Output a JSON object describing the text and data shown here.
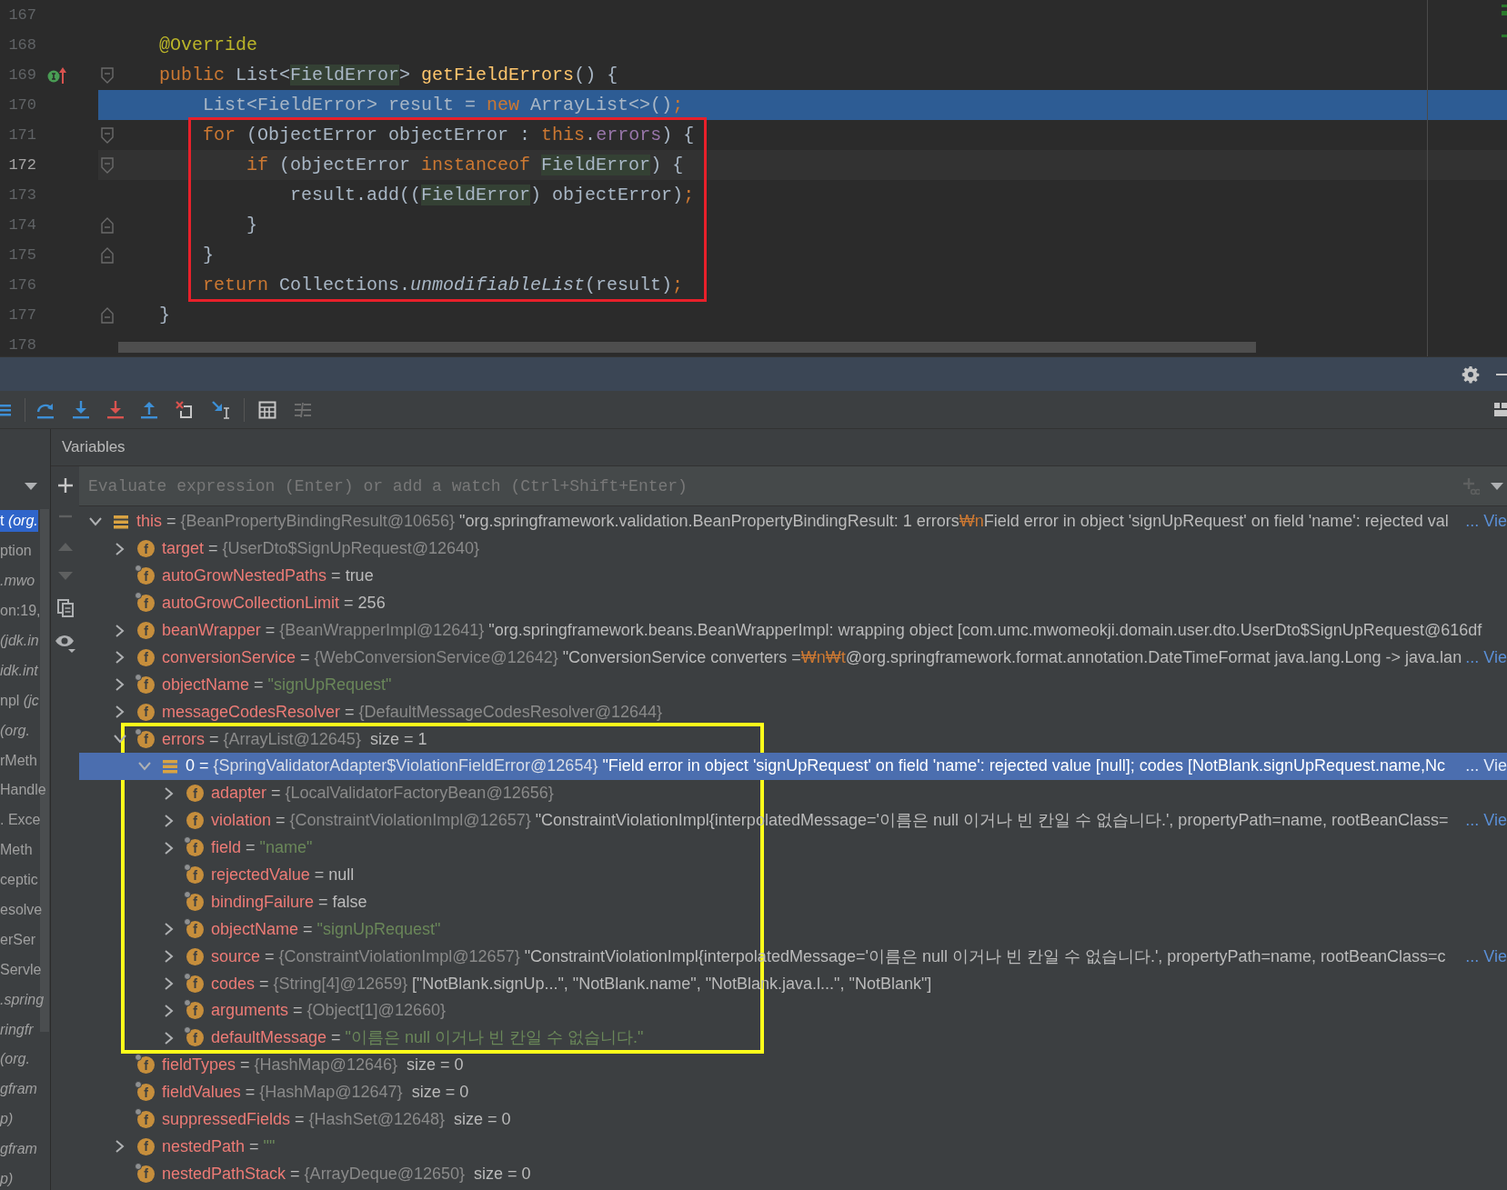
{
  "editor": {
    "lines": [
      {
        "number": "167",
        "execution_point": false,
        "caret": false,
        "boxed": false,
        "implemented": false,
        "fold_start": false,
        "fold_end": false
      },
      {
        "number": "168",
        "execution_point": false,
        "caret": false,
        "boxed": false,
        "implemented": false,
        "fold_start": false,
        "fold_end": false,
        "tokens": [
          {
            "text": "    @Override",
            "kind": "annotation"
          }
        ]
      },
      {
        "number": "169",
        "execution_point": false,
        "caret": false,
        "boxed": false,
        "implemented": true,
        "fold_start": true,
        "fold_end": false,
        "tokens": [
          {
            "text": "    public",
            "kind": "keyword"
          },
          {
            "text": " List<",
            "kind": "plain"
          },
          {
            "text": "FieldError",
            "kind": "usage"
          },
          {
            "text": "> ",
            "kind": "plain"
          },
          {
            "text": "getFieldErrors",
            "kind": "method"
          },
          {
            "text": "() {",
            "kind": "plain"
          }
        ]
      },
      {
        "number": "170",
        "execution_point": true,
        "caret": false,
        "boxed": false,
        "implemented": false,
        "fold_start": false,
        "fold_end": false,
        "tokens": [
          {
            "text": "        List<FieldError> result = ",
            "kind": "plain"
          },
          {
            "text": "new",
            "kind": "keyword"
          },
          {
            "text": " ArrayList<>()",
            "kind": "plain"
          },
          {
            "text": ";",
            "kind": "keyword"
          }
        ]
      },
      {
        "number": "171",
        "execution_point": false,
        "caret": false,
        "boxed": true,
        "implemented": false,
        "fold_start": true,
        "fold_end": false,
        "tokens": [
          {
            "text": "        for",
            "kind": "keyword"
          },
          {
            "text": " (ObjectError objectError : ",
            "kind": "plain"
          },
          {
            "text": "this",
            "kind": "keyword"
          },
          {
            "text": ".",
            "kind": "plain"
          },
          {
            "text": "errors",
            "kind": "field"
          },
          {
            "text": ") {",
            "kind": "plain"
          }
        ]
      },
      {
        "number": "172",
        "execution_point": false,
        "caret": true,
        "boxed": true,
        "implemented": false,
        "fold_start": true,
        "fold_end": false,
        "tokens": [
          {
            "text": "            if",
            "kind": "keyword"
          },
          {
            "text": " (objectError ",
            "kind": "plain"
          },
          {
            "text": "instanceof ",
            "kind": "keyword"
          },
          {
            "text": "FieldError",
            "kind": "usage"
          },
          {
            "text": ") {",
            "kind": "plain"
          }
        ]
      },
      {
        "number": "173",
        "execution_point": false,
        "caret": false,
        "boxed": true,
        "implemented": false,
        "fold_start": false,
        "fold_end": false,
        "tokens": [
          {
            "text": "                result.add((",
            "kind": "plain"
          },
          {
            "text": "FieldError",
            "kind": "usage"
          },
          {
            "text": ") objectError)",
            "kind": "plain"
          },
          {
            "text": ";",
            "kind": "keyword"
          }
        ]
      },
      {
        "number": "174",
        "execution_point": false,
        "caret": false,
        "boxed": true,
        "implemented": false,
        "fold_start": false,
        "fold_end": true,
        "tokens": [
          {
            "text": "            }",
            "kind": "plain"
          }
        ]
      },
      {
        "number": "175",
        "execution_point": false,
        "caret": false,
        "boxed": true,
        "implemented": false,
        "fold_start": false,
        "fold_end": true,
        "tokens": [
          {
            "text": "        }",
            "kind": "plain"
          }
        ]
      },
      {
        "number": "176",
        "execution_point": false,
        "caret": false,
        "boxed": true,
        "implemented": false,
        "fold_start": false,
        "fold_end": false,
        "tokens": [
          {
            "text": "        return",
            "kind": "keyword"
          },
          {
            "text": " Collections.",
            "kind": "plain"
          },
          {
            "text": "unmodifiableList",
            "kind": "static"
          },
          {
            "text": "(result)",
            "kind": "plain"
          },
          {
            "text": ";",
            "kind": "keyword"
          }
        ]
      },
      {
        "number": "177",
        "execution_point": false,
        "caret": false,
        "boxed": false,
        "implemented": false,
        "fold_start": false,
        "fold_end": true,
        "tokens": [
          {
            "text": "    }",
            "kind": "plain"
          }
        ]
      },
      {
        "number": "178",
        "execution_point": false,
        "caret": false,
        "boxed": false,
        "implemented": false,
        "fold_start": false,
        "fold_end": false
      }
    ]
  },
  "frames": [
    {
      "text": "t *(org.*",
      "selected": true
    },
    {
      "text": "ption",
      "selected": false
    },
    {
      "text": "*.mwo*",
      "selected": false
    },
    {
      "text": "on:19,",
      "selected": false
    },
    {
      "text": "*(jdk.in*",
      "selected": false
    },
    {
      "text": "*idk.int*",
      "selected": false
    },
    {
      "text": "npl *(jc*",
      "selected": false
    },
    {
      "text": "*(org.*",
      "selected": false
    },
    {
      "text": "rMeth",
      "selected": false
    },
    {
      "text": "Handle",
      "selected": false
    },
    {
      "text": ". Exce",
      "selected": false
    },
    {
      "text": "Meth",
      "selected": false
    },
    {
      "text": "ceptic",
      "selected": false
    },
    {
      "text": "esolve",
      "selected": false
    },
    {
      "text": "erSer",
      "selected": false
    },
    {
      "text": "Servle",
      "selected": false
    },
    {
      "text": "*.spring*",
      "selected": false
    },
    {
      "text": "*ringfr*",
      "selected": false
    },
    {
      "text": "*(org.*",
      "selected": false
    },
    {
      "text": "*gfram*",
      "selected": false
    },
    {
      "text": "*p)*",
      "selected": false
    },
    {
      "text": "*gfram*",
      "selected": false
    },
    {
      "text": "*p)*",
      "selected": false
    }
  ],
  "variables_title": "Variables",
  "evaluate": {
    "placeholder": "Evaluate expression (Enter) or add a watch (Ctrl+Shift+Enter)"
  },
  "separator": "=",
  "variables": [
    {
      "kind": "object",
      "name": "this",
      "expanded": true,
      "selected": false,
      "boxed": false,
      "type_ref": "{BeanPropertyBindingResult@10656}",
      "value": [
        {
          "text": "\"org.springframework.validation.BeanPropertyBindingResult: 1 errors",
          "kind": "plain"
        },
        {
          "text": "₩n",
          "kind": "escape"
        },
        {
          "text": "Field error in object 'signUpRequest' on field 'name': rejected val",
          "kind": "plain"
        }
      ],
      "link": "... Vie",
      "children": [
        {
          "kind": "field",
          "badge": "f",
          "final": false,
          "name": "target",
          "expanded": false,
          "selected": false,
          "boxed": false,
          "type_ref": "{UserDto$SignUpRequest@12640}"
        },
        {
          "kind": "field",
          "badge": "f",
          "final": true,
          "name": "autoGrowNestedPaths",
          "selected": false,
          "boxed": false,
          "value": [
            {
              "text": "true",
              "kind": "plain"
            }
          ]
        },
        {
          "kind": "field",
          "badge": "f",
          "final": true,
          "name": "autoGrowCollectionLimit",
          "selected": false,
          "boxed": false,
          "value": [
            {
              "text": "256",
              "kind": "plain"
            }
          ]
        },
        {
          "kind": "field",
          "badge": "f",
          "final": false,
          "name": "beanWrapper",
          "expanded": false,
          "selected": false,
          "boxed": false,
          "type_ref": "{BeanWrapperImpl@12641}",
          "value": [
            {
              "text": "\"org.springframework.beans.BeanWrapperImpl: wrapping object [com.umc.mwomeokji.domain.user.dto.UserDto$SignUpRequest@616df",
              "kind": "plain"
            }
          ]
        },
        {
          "kind": "field",
          "badge": "f",
          "final": false,
          "name": "conversionService",
          "expanded": false,
          "selected": false,
          "boxed": false,
          "type_ref": "{WebConversionService@12642}",
          "value": [
            {
              "text": "\"ConversionService converters =",
              "kind": "plain"
            },
            {
              "text": "₩n₩t",
              "kind": "escape"
            },
            {
              "text": "@org.springframework.format.annotation.DateTimeFormat java.lang.Long -> java.lan",
              "kind": "plain"
            }
          ],
          "link": "... Vie"
        },
        {
          "kind": "field",
          "badge": "f",
          "final": true,
          "name": "objectName",
          "expanded": false,
          "selected": false,
          "boxed": false,
          "value": [
            {
              "text": "\"signUpRequest\"",
              "kind": "string"
            }
          ]
        },
        {
          "kind": "field",
          "badge": "f",
          "final": false,
          "name": "messageCodesResolver",
          "expanded": false,
          "selected": false,
          "boxed": false,
          "type_ref": "{DefaultMessageCodesResolver@12644}"
        },
        {
          "kind": "field",
          "badge": "f",
          "final": true,
          "name": "errors",
          "expanded": true,
          "selected": false,
          "boxed": true,
          "type_ref": "{ArrayList@12645}",
          "size": "size = 1",
          "children": [
            {
              "kind": "object",
              "name": "0",
              "expanded": true,
              "selected": true,
              "boxed": false,
              "type_ref": "{SpringValidatorAdapter$ViolationFieldError@12654}",
              "value": [
                {
                  "text": "\"Field error in object 'signUpRequest' on field 'name': rejected value [null]; codes [NotBlank.signUpRequest.name,Nc",
                  "kind": "plain"
                }
              ],
              "link": "... Vie",
              "children": [
                {
                  "kind": "field",
                  "badge": "f",
                  "final": false,
                  "name": "adapter",
                  "expanded": false,
                  "selected": false,
                  "boxed": false,
                  "type_ref": "{LocalValidatorFactoryBean@12656}"
                },
                {
                  "kind": "field",
                  "badge": "f",
                  "final": false,
                  "name": "violation",
                  "expanded": false,
                  "selected": false,
                  "boxed": false,
                  "type_ref": "{ConstraintViolationImpl@12657}",
                  "value": [
                    {
                      "text": "\"ConstraintViolationImpl{interpolatedMessage='이름은 null 이거나 빈 칸일 수 없습니다.', propertyPath=name, rootBeanClass=",
                      "kind": "plain"
                    }
                  ],
                  "link": "... Vie"
                },
                {
                  "kind": "field",
                  "badge": "f",
                  "final": true,
                  "name": "field",
                  "expanded": false,
                  "selected": false,
                  "boxed": false,
                  "value": [
                    {
                      "text": "\"name\"",
                      "kind": "string"
                    }
                  ]
                },
                {
                  "kind": "field",
                  "badge": "f",
                  "final": true,
                  "name": "rejectedValue",
                  "selected": false,
                  "boxed": false,
                  "value": [
                    {
                      "text": "null",
                      "kind": "plain"
                    }
                  ]
                },
                {
                  "kind": "field",
                  "badge": "f",
                  "final": true,
                  "name": "bindingFailure",
                  "selected": false,
                  "boxed": false,
                  "value": [
                    {
                      "text": "false",
                      "kind": "plain"
                    }
                  ]
                },
                {
                  "kind": "field",
                  "badge": "f",
                  "final": true,
                  "name": "objectName",
                  "expanded": false,
                  "selected": false,
                  "boxed": false,
                  "value": [
                    {
                      "text": "\"signUpRequest\"",
                      "kind": "string"
                    }
                  ]
                },
                {
                  "kind": "field",
                  "badge": "f",
                  "final": false,
                  "name": "source",
                  "expanded": false,
                  "selected": false,
                  "boxed": false,
                  "type_ref": "{ConstraintViolationImpl@12657}",
                  "value": [
                    {
                      "text": "\"ConstraintViolationImpl{interpolatedMessage='이름은 null 이거나 빈 칸일 수 없습니다.', propertyPath=name, rootBeanClass=c",
                      "kind": "plain"
                    }
                  ],
                  "link": "... Vie"
                },
                {
                  "kind": "field",
                  "badge": "f",
                  "final": true,
                  "name": "codes",
                  "expanded": false,
                  "selected": false,
                  "boxed": false,
                  "type_ref": "{String[4]@12659}",
                  "value": [
                    {
                      "text": "[\"NotBlank.signUp...\", \"NotBlank.name\", \"NotBlank.java.l...\", \"NotBlank\"]",
                      "kind": "plain"
                    }
                  ]
                },
                {
                  "kind": "field",
                  "badge": "f",
                  "final": true,
                  "name": "arguments",
                  "expanded": false,
                  "selected": false,
                  "boxed": false,
                  "type_ref": "{Object[1]@12660}"
                },
                {
                  "kind": "field",
                  "badge": "f",
                  "final": true,
                  "name": "defaultMessage",
                  "expanded": false,
                  "selected": false,
                  "boxed": false,
                  "value": [
                    {
                      "text": "\"이름은 null 이거나 빈 칸일 수 없습니다.\"",
                      "kind": "string"
                    }
                  ]
                }
              ]
            }
          ]
        },
        {
          "kind": "field",
          "badge": "f",
          "final": true,
          "name": "fieldTypes",
          "selected": false,
          "boxed": false,
          "type_ref": "{HashMap@12646}",
          "size": "size = 0"
        },
        {
          "kind": "field",
          "badge": "f",
          "final": true,
          "name": "fieldValues",
          "selected": false,
          "boxed": false,
          "type_ref": "{HashMap@12647}",
          "size": "size = 0"
        },
        {
          "kind": "field",
          "badge": "f",
          "final": true,
          "name": "suppressedFields",
          "selected": false,
          "boxed": false,
          "type_ref": "{HashSet@12648}",
          "size": "size = 0"
        },
        {
          "kind": "field",
          "badge": "f",
          "final": false,
          "name": "nestedPath",
          "expanded": false,
          "selected": false,
          "boxed": false,
          "value": [
            {
              "text": "\"\"",
              "kind": "string"
            }
          ]
        },
        {
          "kind": "field",
          "badge": "f",
          "final": true,
          "name": "nestedPathStack",
          "selected": false,
          "boxed": false,
          "type_ref": "{ArrayDeque@12650}",
          "size": "size = 0"
        }
      ]
    }
  ]
}
